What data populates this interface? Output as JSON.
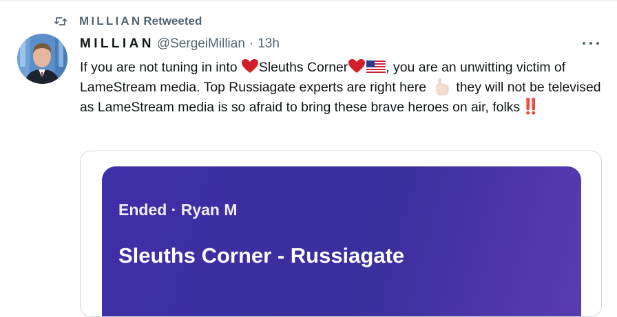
{
  "retweet": {
    "name": "MILLIAN",
    "label": "Retweeted"
  },
  "tweet": {
    "author_name": "MILLIAN",
    "handle": "@SergeiMillian",
    "separator": "·",
    "time": "13h",
    "text_part1": "If you are not tuning in into ",
    "text_part2": "Sleuths Corner",
    "text_part3": ", you are an unwitting victim of LameStream media. Top Russiagate experts are right here ",
    "text_part4": "they will not be televised as LameStream media is so afraid to bring these brave heroes on air, folks",
    "bangs": "‼️"
  },
  "space_card": {
    "status": "Ended",
    "separator": "·",
    "host": "Ryan M",
    "title": "Sleuths Corner - Russiagate"
  },
  "icons": {
    "retweet": "retweet-icon",
    "more": "more-dots-icon",
    "heart": "red-heart-emoji",
    "flag": "us-flag-emoji",
    "finger": "pointing-down-emoji"
  },
  "colors": {
    "text_primary": "#0f1419",
    "text_secondary": "#536471",
    "card_purple": "#3f2fa8",
    "heart_red": "#d01f2b",
    "border": "#cfd9de"
  }
}
